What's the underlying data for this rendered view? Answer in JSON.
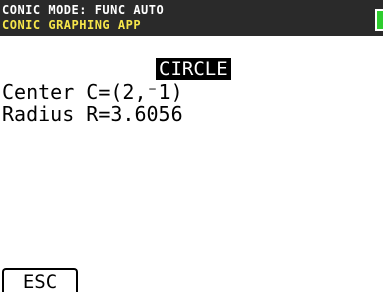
{
  "status_bar": {
    "mode_text": "CONIC MODE: FUNC AUTO",
    "app_text": "CONIC GRAPHING APP",
    "battery_color": "#2ecc2e"
  },
  "main": {
    "title": "CIRCLE",
    "center_line": "Center C=(2,⁻1)",
    "radius_line": "Radius R=3.6056"
  },
  "softkeys": {
    "esc_label": "ESC"
  }
}
